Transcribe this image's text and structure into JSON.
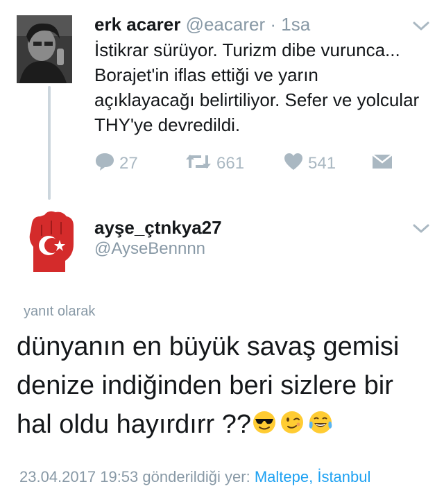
{
  "tweet1": {
    "name": "erk acarer",
    "handle": "@eacarer",
    "separator": "·",
    "time": "1sa",
    "text": "İstikrar sürüyor. Turizm dibe vurunca... Borajet'in iflas ettiği ve yarın açıklayacağı belirtiliyor. Sefer ve yolcular THY'ye devredildi.",
    "replies": "27",
    "retweets": "661",
    "likes": "541"
  },
  "tweet2": {
    "name": "ayşe_çtnkya27",
    "handle": "@AyseBennnn",
    "reply_label": "yanıt olarak",
    "text": "dünyanın en büyük savaş gemisi denize indiğinden beri sizlere bir hal oldu hayırdırr ??",
    "emojis": [
      "sunglasses-emoji",
      "wink-emoji",
      "tears-of-joy-emoji"
    ],
    "date": "23.04.2017 19:53",
    "sent_from": "gönderildiği yer:",
    "location": "Maltepe, İstanbul"
  },
  "colors": {
    "text": "#14171a",
    "secondary": "#8899a6",
    "icon": "#aab8c2",
    "link": "#1da1f2",
    "thread_line": "#ccd6dd"
  }
}
